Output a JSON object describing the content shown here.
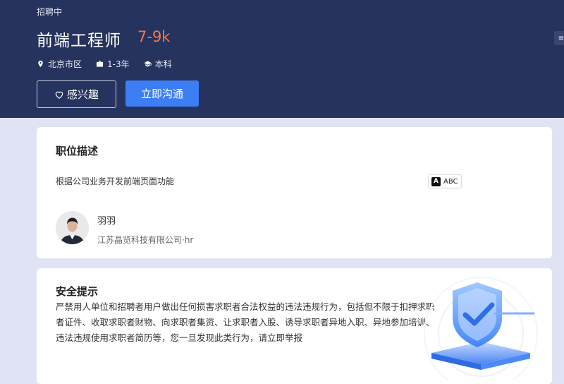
{
  "job": {
    "status": "招聘中",
    "title": "前端工程师",
    "salary": "7-9k",
    "location": "北京市区",
    "experience": "1-3年",
    "education": "本科"
  },
  "actions": {
    "interest_label": "感兴趣",
    "chat_label": "立即沟通"
  },
  "description": {
    "heading": "职位描述",
    "text": "根据公司业务开发前端页面功能",
    "translate_label": "ABC"
  },
  "recruiter": {
    "name": "羽羽",
    "company": "江苏晶览科技有限公司·hr"
  },
  "safety": {
    "heading": "安全提示",
    "text": "严禁用人单位和招聘者用户做出任何损害求职者合法权益的违法违规行为，包括但不限于扣押求职者证件、收取求职者财物、向求职者集资、让求职者入股、诱导求职者异地入职、异地参加培训、违法违规使用求职者简历等，您一旦发现此类行为，请立即举报"
  },
  "colors": {
    "header_bg": "#26335e",
    "salary": "#f07849",
    "primary": "#3d7ef5",
    "page_bg": "#e0e3f3"
  }
}
